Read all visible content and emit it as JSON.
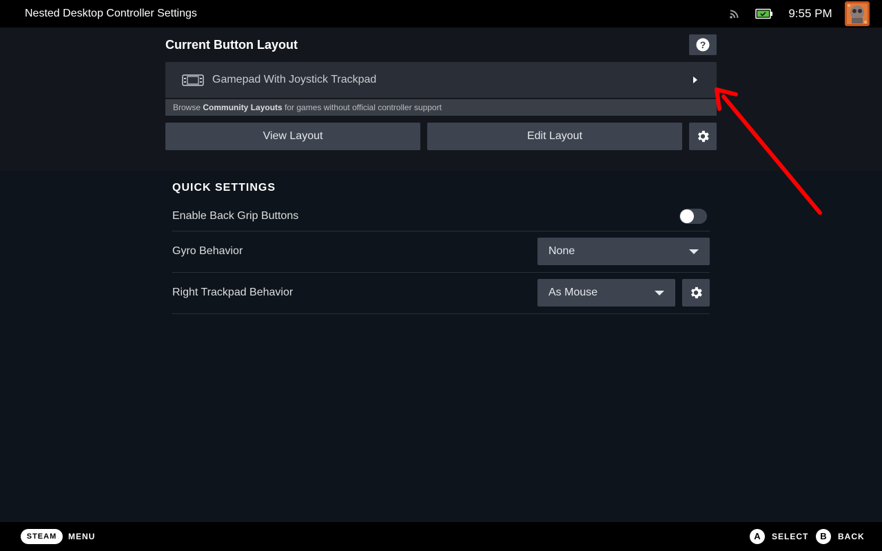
{
  "window": {
    "title": "Nested Desktop Controller Settings",
    "clock": "9:55 PM",
    "icons": [
      "rss-icon",
      "battery-icon",
      "avatar"
    ]
  },
  "layout_section": {
    "title": "Current Button Layout",
    "help_icon": "question-icon",
    "current_layout": "Gamepad With Joystick Trackpad",
    "layout_icon": "controller-icon",
    "browse_prefix": "Browse ",
    "browse_link": "Community Layouts",
    "browse_suffix": " for games without official controller support",
    "view_button": "View Layout",
    "edit_button": "Edit Layout",
    "settings_icon": "gear-icon"
  },
  "quick_settings": {
    "title": "QUICK SETTINGS",
    "rows": [
      {
        "label": "Enable Back Grip Buttons",
        "control": "toggle",
        "value": false
      },
      {
        "label": "Gyro Behavior",
        "control": "dropdown",
        "value": "None"
      },
      {
        "label": "Right Trackpad Behavior",
        "control": "dropdown",
        "value": "As Mouse",
        "has_settings": true
      }
    ]
  },
  "annotation": {
    "type": "arrow",
    "color": "#ff0000"
  },
  "footer": {
    "steam": "STEAM",
    "menu": "MENU",
    "a_glyph": "A",
    "select": "SELECT",
    "b_glyph": "B",
    "back": "BACK"
  },
  "colors": {
    "background": "#0e141b",
    "panel": "#13171d",
    "button": "#3d4450",
    "accent_battery": "#59bf40",
    "arrow": "#ff0000"
  }
}
